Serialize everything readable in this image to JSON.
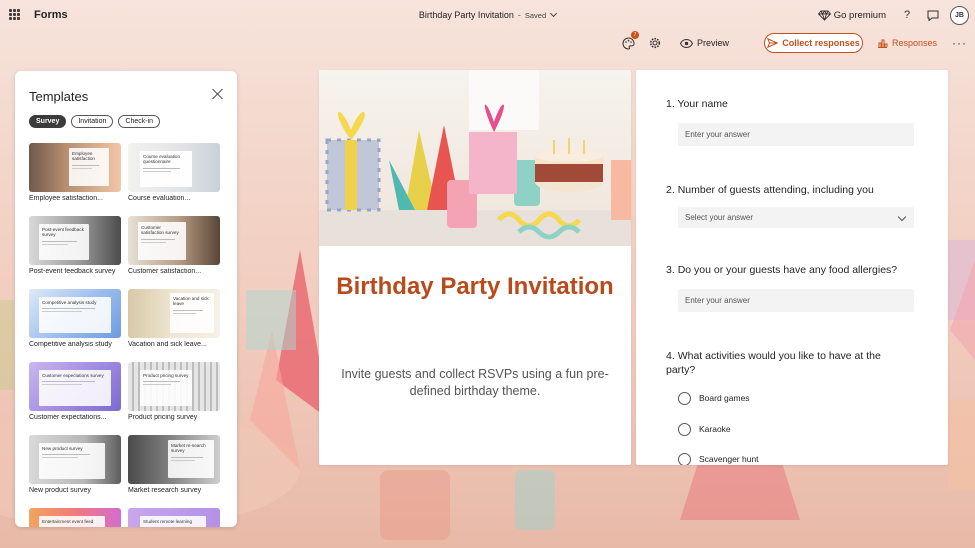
{
  "header": {
    "app_name": "Forms",
    "doc_title": "Birthday Party Invitation",
    "separator": "-",
    "status": "Saved",
    "premium_label": "Go premium",
    "avatar_initials": "JB",
    "help_label": "?"
  },
  "toolbar": {
    "badge_count": "7",
    "preview_label": "Preview",
    "collect_label": "Collect responses",
    "responses_label": "Responses",
    "more_label": "···"
  },
  "templates": {
    "title": "Templates",
    "chips": [
      "Survey",
      "Invitation",
      "Check-in"
    ],
    "active_chip": "Survey",
    "items": [
      {
        "label": "Employee satisfaction...",
        "thumb_text": "Employee satisfaction"
      },
      {
        "label": "Course evaluation...",
        "thumb_text": "Course evaluation questionnaire"
      },
      {
        "label": "Post-event feedback survey",
        "thumb_text": "Post-event feedback survey"
      },
      {
        "label": "Customer satisfaction...",
        "thumb_text": "Customer satisfaction survey"
      },
      {
        "label": "Competitive analysis study",
        "thumb_text": "Competitive analysis study"
      },
      {
        "label": "Vacation and sick leave...",
        "thumb_text": "Vacation and sick leave"
      },
      {
        "label": "Customer expectations...",
        "thumb_text": "Customer expectations survey"
      },
      {
        "label": "Product pricing survey",
        "thumb_text": "Product pricing survey"
      },
      {
        "label": "New product survey",
        "thumb_text": "New product survey"
      },
      {
        "label": "Market research survey",
        "thumb_text": "Market re-search survey"
      },
      {
        "label": "",
        "thumb_text": "Entertainment event feed"
      },
      {
        "label": "",
        "thumb_text": "Student remote learning"
      }
    ]
  },
  "cover": {
    "title": "Birthday Party Invitation",
    "description": "Invite guests and collect RSVPs using a fun pre-defined birthday theme."
  },
  "questions": [
    {
      "number": "1.",
      "text": "Your name",
      "placeholder": "Enter your answer"
    },
    {
      "number": "2.",
      "text": "Number of guests attending, including you",
      "placeholder": "Select your answer"
    },
    {
      "number": "3.",
      "text": "Do you or your guests have any food allergies?",
      "placeholder": "Enter your answer"
    },
    {
      "number": "4.",
      "text": "What activities would you like to have at the party?",
      "options": [
        "Board games",
        "Karaoke",
        "Scavenger hunt"
      ]
    }
  ],
  "colors": {
    "accent": "#c4501b",
    "title": "#b94a1c"
  },
  "icons": [
    "waffle-icon",
    "diamond-icon",
    "help-icon",
    "feedback-icon",
    "more-icon",
    "palette-icon",
    "settings-icon",
    "eye-icon",
    "send-icon",
    "chart-icon",
    "close-icon",
    "chevron-down-icon",
    "radio-icon"
  ]
}
